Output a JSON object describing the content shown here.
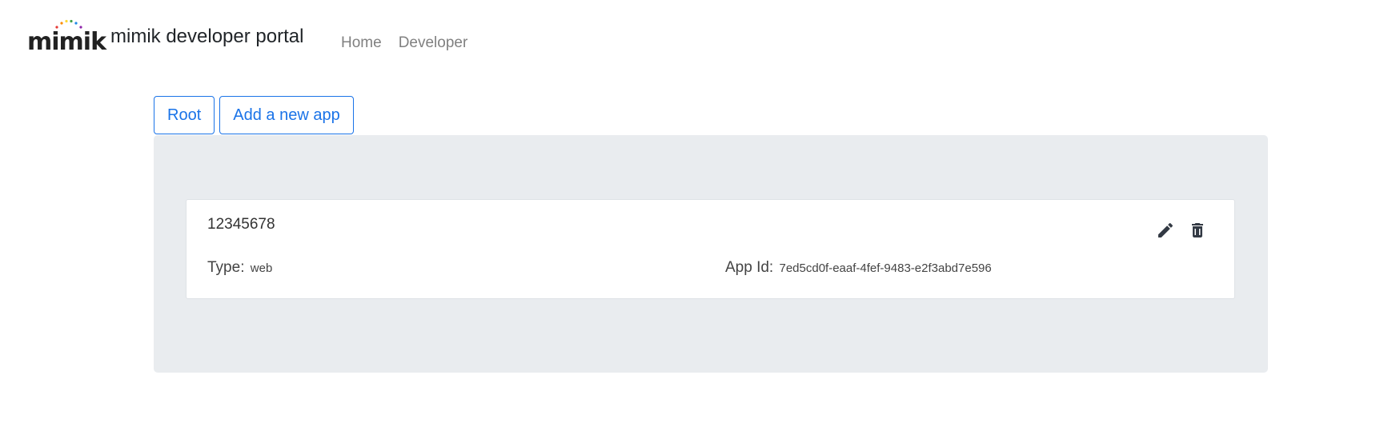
{
  "header": {
    "logo_text": "mimik",
    "title": "mimik developer portal",
    "nav": [
      {
        "label": "Home"
      },
      {
        "label": "Developer"
      }
    ]
  },
  "toolbar": {
    "root_label": "Root",
    "add_label": "Add a new app"
  },
  "apps": [
    {
      "name": "12345678",
      "type_label": "Type:",
      "type_value": "web",
      "app_id_label": "App Id:",
      "app_id_value": "7ed5cd0f-eaaf-4fef-9483-e2f3abd7e596",
      "edit_icon": "pencil-icon",
      "delete_icon": "trash-icon"
    }
  ],
  "colors": {
    "accent": "#1a73e8",
    "panel_bg": "#e9ecef",
    "nav_text": "#808080",
    "logo_dots": [
      "#e53935",
      "#fb8c00",
      "#fdd835",
      "#43a047",
      "#1e88e5",
      "#8e24aa"
    ]
  }
}
